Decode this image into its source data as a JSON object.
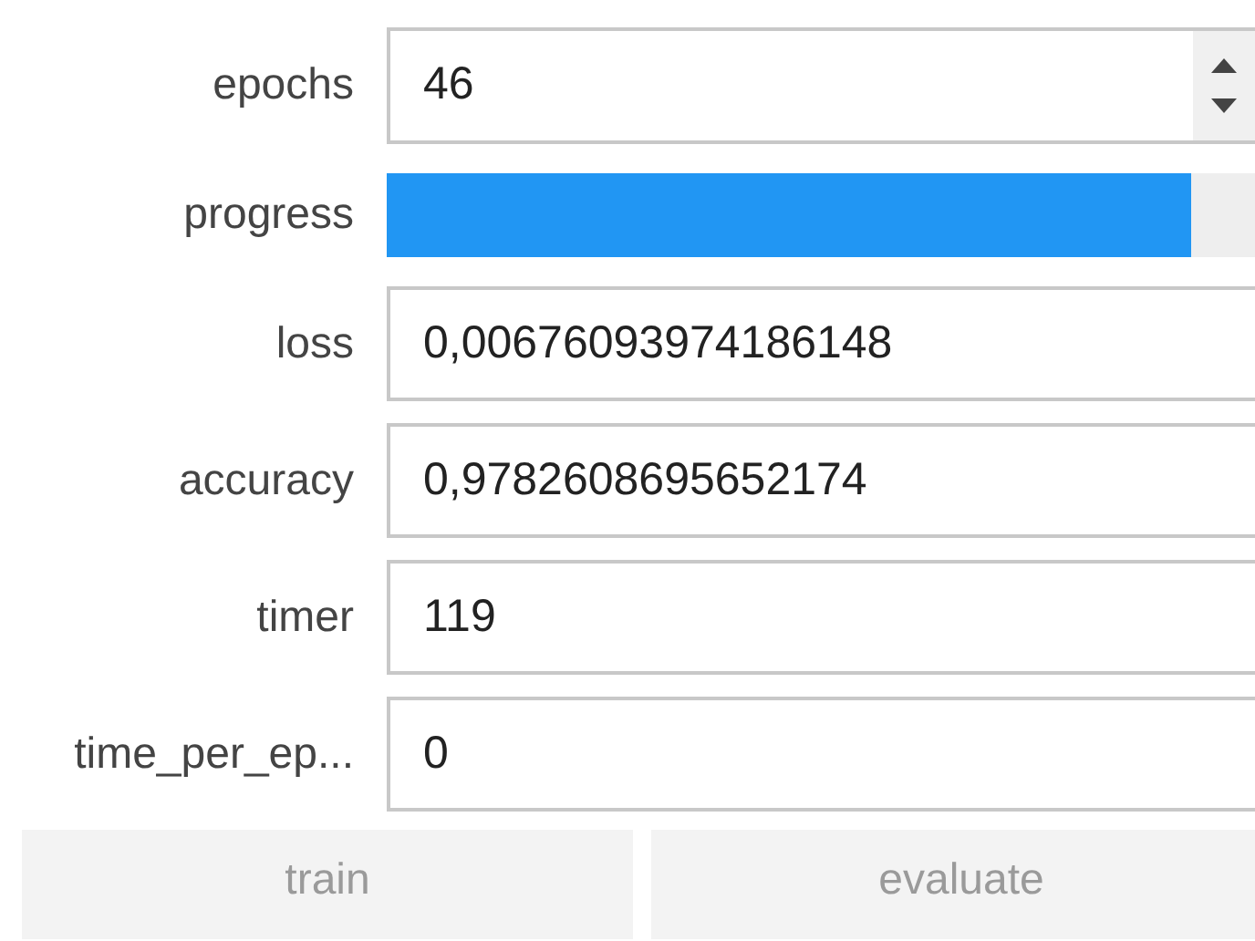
{
  "rows": [
    {
      "kind": "spin",
      "label": "epochs",
      "value": "46"
    },
    {
      "kind": "progress",
      "label": "progress",
      "level": 0.9
    },
    {
      "kind": "text",
      "label": "loss",
      "value": "0,00676093974186148"
    },
    {
      "kind": "text",
      "label": "accuracy",
      "value": "0,9782608695652174"
    },
    {
      "kind": "text",
      "label": "timer",
      "value": "119"
    },
    {
      "kind": "text",
      "label": "time_per_ep...",
      "value": "0"
    }
  ],
  "buttons": [
    {
      "label": "train",
      "disabled": true
    },
    {
      "label": "evaluate",
      "disabled": true
    }
  ]
}
